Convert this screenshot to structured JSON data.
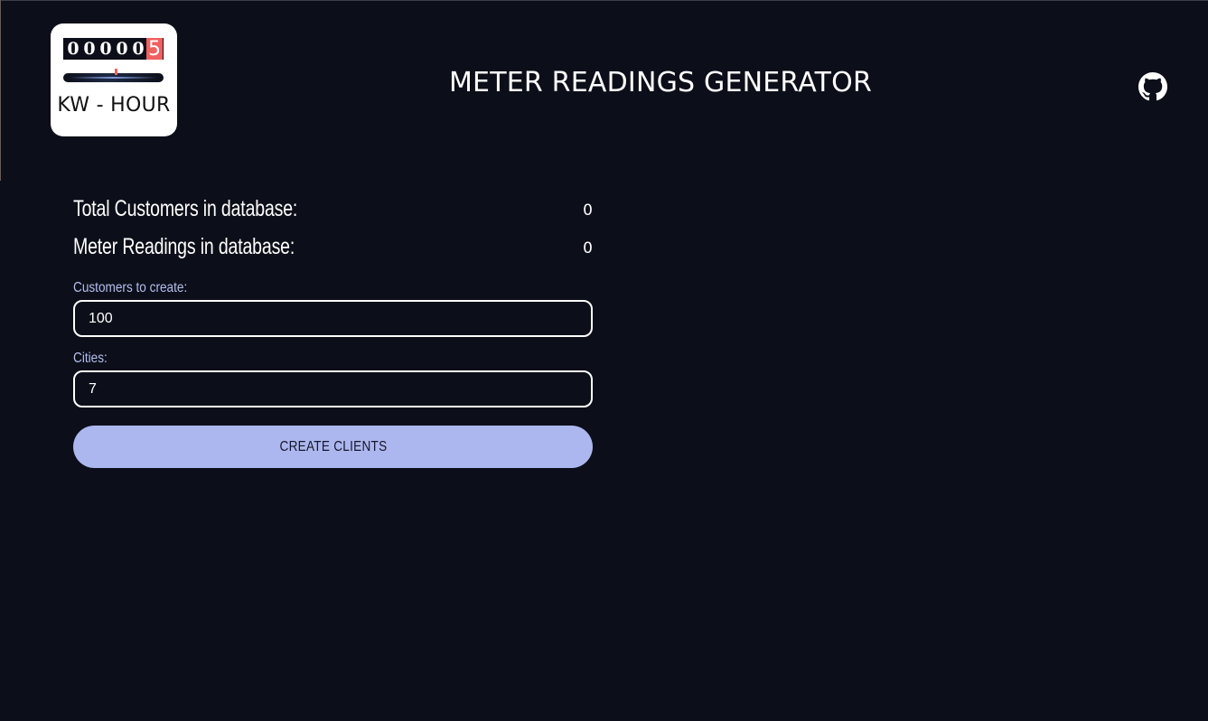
{
  "logo": {
    "digits": [
      "0",
      "0",
      "0",
      "0",
      "0",
      "5"
    ],
    "unit": "KW - HOUR",
    "accent_color": "#f06060"
  },
  "header": {
    "title": "METER READINGS GENERATOR",
    "github_icon": "github-icon"
  },
  "stats": {
    "total_customers_label": "Total Customers in database:",
    "total_customers_value": "0",
    "meter_readings_label": "Meter Readings in database:",
    "meter_readings_value": "0"
  },
  "form": {
    "customers_label": "Customers to create:",
    "customers_value": "100",
    "cities_label": "Cities:",
    "cities_value": "7",
    "submit_label": "CREATE CLIENTS"
  },
  "colors": {
    "background": "#0c0f19",
    "button": "#adb7ef",
    "label": "#b4bff0"
  }
}
